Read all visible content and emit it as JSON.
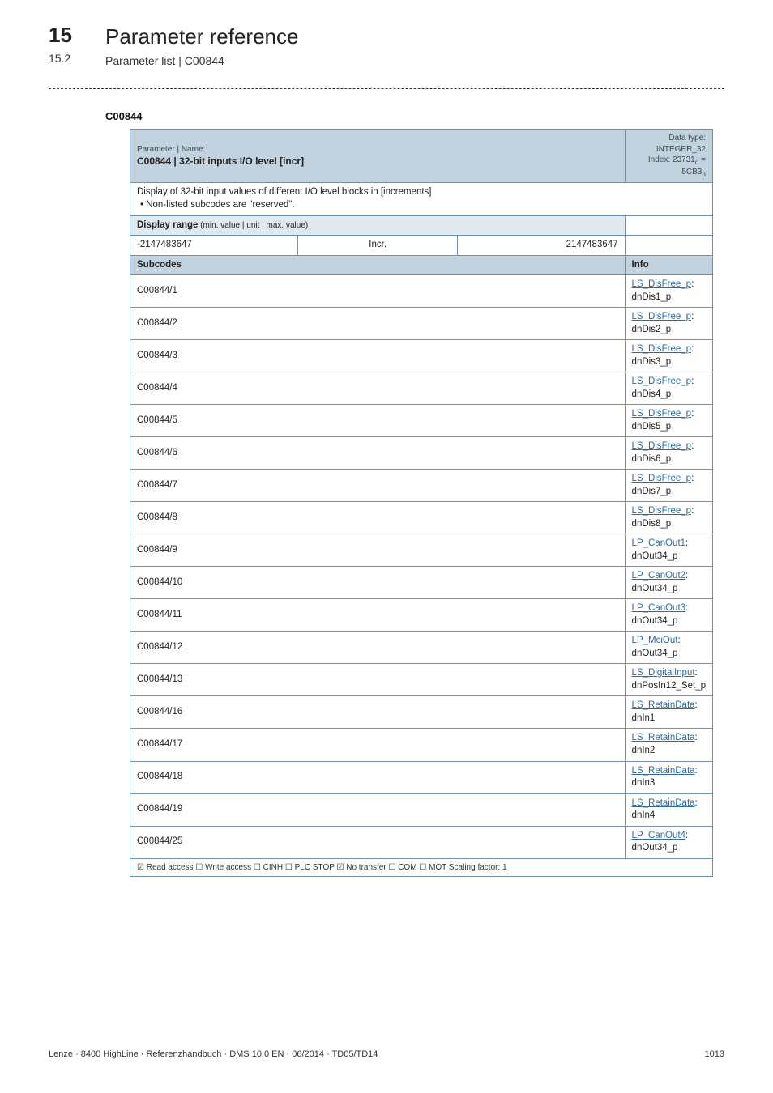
{
  "header": {
    "section_num": "15",
    "section_title": "Parameter reference",
    "sub_num": "15.2",
    "sub_title": "Parameter list | C00844"
  },
  "anchor": "C00844",
  "param_header": {
    "label": "Parameter | Name:",
    "main": "C00844 | 32-bit inputs I/O level [incr]",
    "right_line1": "Data type: INTEGER_32",
    "right_line2_pre": "Index: 23731",
    "right_line2_sub1": "d",
    "right_line2_mid": " = 5CB3",
    "right_line2_sub2": "h"
  },
  "description": {
    "line1": "Display of 32-bit input values of different I/O level blocks in [increments]",
    "line2": "• Non-listed subcodes are \"reserved\"."
  },
  "display_range": {
    "label_bold": "Display range",
    "label_small": " (min. value | unit | max. value)",
    "min": "-2147483647",
    "unit": "Incr.",
    "max": "2147483647"
  },
  "columns": {
    "subcodes": "Subcodes",
    "info": "Info"
  },
  "rows": [
    {
      "sub": "C00844/1",
      "link": "LS_DisFree_p",
      "rest": ": dnDis1_p"
    },
    {
      "sub": "C00844/2",
      "link": "LS_DisFree_p",
      "rest": ": dnDis2_p"
    },
    {
      "sub": "C00844/3",
      "link": "LS_DisFree_p",
      "rest": ": dnDis3_p"
    },
    {
      "sub": "C00844/4",
      "link": "LS_DisFree_p",
      "rest": ": dnDis4_p"
    },
    {
      "sub": "C00844/5",
      "link": "LS_DisFree_p",
      "rest": ": dnDis5_p"
    },
    {
      "sub": "C00844/6",
      "link": "LS_DisFree_p",
      "rest": ": dnDis6_p"
    },
    {
      "sub": "C00844/7",
      "link": "LS_DisFree_p",
      "rest": ": dnDis7_p"
    },
    {
      "sub": "C00844/8",
      "link": "LS_DisFree_p",
      "rest": ": dnDis8_p"
    },
    {
      "sub": "C00844/9",
      "link": "LP_CanOut1",
      "rest": ": dnOut34_p"
    },
    {
      "sub": "C00844/10",
      "link": "LP_CanOut2",
      "rest": ": dnOut34_p"
    },
    {
      "sub": "C00844/11",
      "link": "LP_CanOut3",
      "rest": ": dnOut34_p"
    },
    {
      "sub": "C00844/12",
      "link": "LP_MciOut",
      "rest": ": dnOut34_p"
    },
    {
      "sub": "C00844/13",
      "link": "LS_DigitalInput",
      "rest": ": dnPosIn12_Set_p"
    },
    {
      "sub": "C00844/16",
      "link": "LS_RetainData",
      "rest": ": dnIn1"
    },
    {
      "sub": "C00844/17",
      "link": "LS_RetainData",
      "rest": ": dnIn2"
    },
    {
      "sub": "C00844/18",
      "link": "LS_RetainData",
      "rest": ": dnIn3"
    },
    {
      "sub": "C00844/19",
      "link": "LS_RetainData",
      "rest": ": dnIn4"
    },
    {
      "sub": "C00844/25",
      "link": "LP_CanOut4",
      "rest": ": dnOut34_p"
    }
  ],
  "access_row": "☑ Read access  ☐ Write access  ☐ CINH  ☐ PLC STOP  ☑ No transfer  ☐ COM  ☐ MOT   Scaling factor: 1",
  "footer": {
    "left": "Lenze · 8400 HighLine · Referenzhandbuch · DMS 10.0 EN · 06/2014 · TD05/TD14",
    "right": "1013"
  }
}
